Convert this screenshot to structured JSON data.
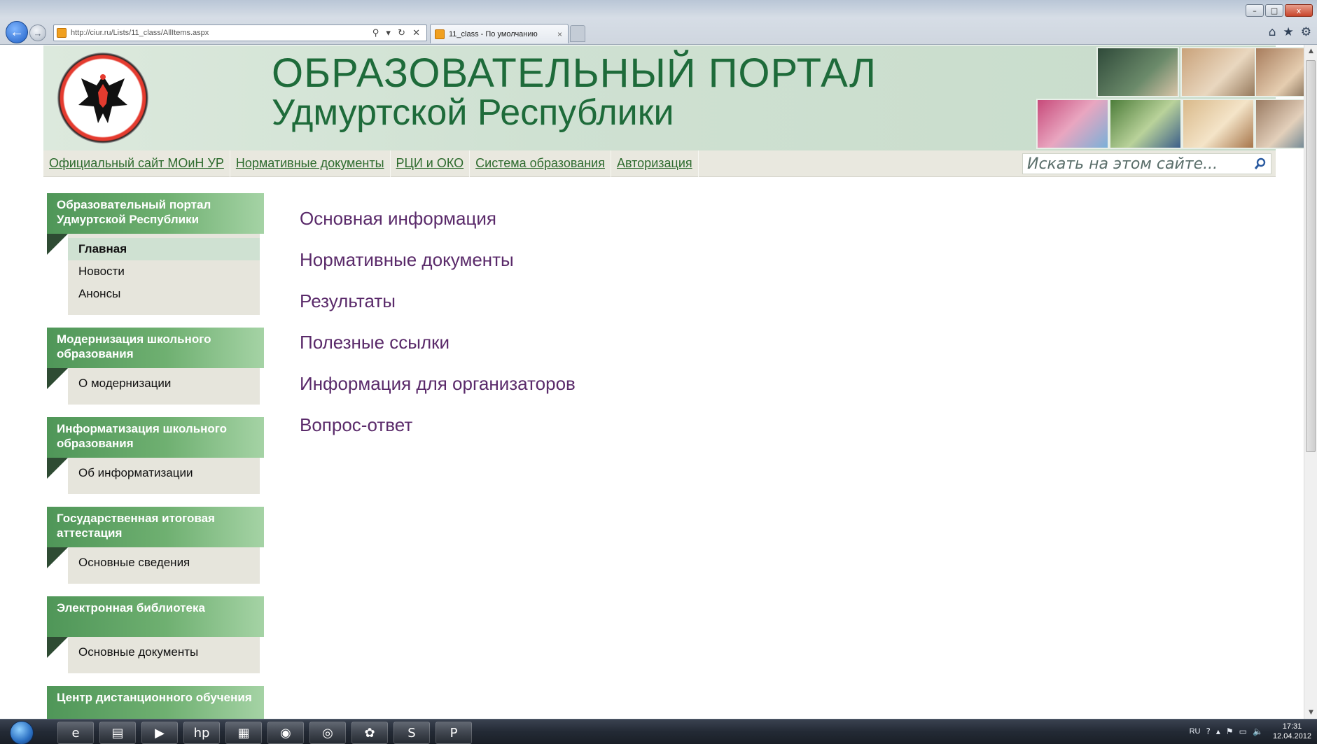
{
  "browser": {
    "address": "http://ciur.ru/Lists/11_class/AllItems.aspx",
    "tab_title": "11_class - По умолчанию",
    "address_tools": "⚲ ▾ ↻ ✕",
    "tab_close": "×",
    "back_glyph": "←",
    "forward_glyph": "→",
    "right_tools": [
      "⌂",
      "★",
      "⚙"
    ],
    "window_controls": [
      "–",
      "□",
      "x"
    ]
  },
  "header": {
    "title_line1": "ОБРАЗОВАТЕЛЬНЫЙ ПОРТАЛ",
    "title_line2": "Удмуртской Республики",
    "title_color": "#1e6b3a"
  },
  "topnav": {
    "links": [
      "Официальный сайт МОиН УР",
      "Нормативные документы",
      "РЦИ и ОКО",
      "Система образования",
      "Авторизация"
    ],
    "search_placeholder": "Искать на этом сайте...",
    "search_icon": "search-icon"
  },
  "leftnav": {
    "groups": [
      {
        "title": "Образовательный портал Удмуртской Республики",
        "items": [
          "Главная",
          "Новости",
          "Анонсы"
        ]
      },
      {
        "title": "Модернизация школьного образования",
        "items": [
          "О модернизации"
        ]
      },
      {
        "title": "Информатизация школьного образования",
        "items": [
          "Об информатизации"
        ]
      },
      {
        "title": "Государственная итоговая аттестация",
        "items": [
          "Основные сведения"
        ]
      },
      {
        "title": "Электронная библиотека",
        "items": [
          "Основные документы"
        ]
      },
      {
        "title": "Центр дистанционного обучения",
        "items": []
      }
    ],
    "accent": "#4f9658"
  },
  "content": {
    "links": [
      "Основная информация",
      "Нормативные документы",
      "Результаты",
      "Полезные ссылки",
      "Информация для организаторов",
      "Вопрос-ответ"
    ],
    "link_color": "#5a2a6a"
  },
  "taskbar": {
    "lang": "RU",
    "time": "17:31",
    "date": "12.04.2012",
    "help_glyph": "?",
    "tray_glyphs": [
      "▴",
      "⚑",
      "▭",
      "🔈"
    ]
  }
}
